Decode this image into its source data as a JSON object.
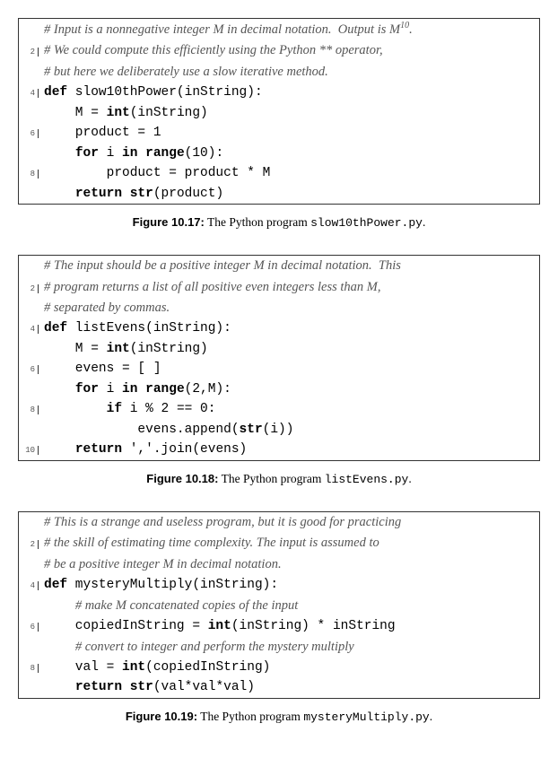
{
  "figures": [
    {
      "caption_label": "Figure 10.17:",
      "caption_text_pre": " The Python program ",
      "caption_tt": "slow10thPower.py",
      "caption_text_post": ".",
      "lines": [
        {
          "num": "",
          "parts": [
            {
              "t": "# Input is a nonnegative integer M in decimal notation.  Output is M",
              "cls": "comment"
            },
            {
              "t": "10",
              "cls": "comment sup",
              "raw": true
            },
            {
              "t": ".",
              "cls": "comment"
            }
          ]
        },
        {
          "num": "2",
          "parts": [
            {
              "t": "# We could compute this efficiently using the Python ** operator,",
              "cls": "comment"
            }
          ]
        },
        {
          "num": "",
          "parts": [
            {
              "t": "# but here we deliberately use a slow iterative method.",
              "cls": "comment"
            }
          ]
        },
        {
          "num": "4",
          "parts": [
            {
              "t": "def",
              "cls": "keyword"
            },
            {
              "t": " slow10thPower(inString):"
            }
          ]
        },
        {
          "num": "",
          "parts": [
            {
              "t": "    M = "
            },
            {
              "t": "int",
              "cls": "builtin"
            },
            {
              "t": "(inString)"
            }
          ]
        },
        {
          "num": "6",
          "parts": [
            {
              "t": "    product = 1"
            }
          ]
        },
        {
          "num": "",
          "parts": [
            {
              "t": "    "
            },
            {
              "t": "for",
              "cls": "keyword"
            },
            {
              "t": " i "
            },
            {
              "t": "in",
              "cls": "keyword"
            },
            {
              "t": " "
            },
            {
              "t": "range",
              "cls": "builtin"
            },
            {
              "t": "(10):"
            }
          ]
        },
        {
          "num": "8",
          "parts": [
            {
              "t": "        product = product * M"
            }
          ]
        },
        {
          "num": "",
          "parts": [
            {
              "t": "    "
            },
            {
              "t": "return",
              "cls": "keyword"
            },
            {
              "t": " "
            },
            {
              "t": "str",
              "cls": "builtin"
            },
            {
              "t": "(product)"
            }
          ]
        }
      ]
    },
    {
      "caption_label": "Figure 10.18:",
      "caption_text_pre": " The Python program ",
      "caption_tt": "listEvens.py",
      "caption_text_post": ".",
      "lines": [
        {
          "num": "",
          "parts": [
            {
              "t": "# The input should be a positive integer M in decimal notation.  This",
              "cls": "comment"
            }
          ]
        },
        {
          "num": "2",
          "parts": [
            {
              "t": "# program returns a list of all positive even integers less than M,",
              "cls": "comment"
            }
          ]
        },
        {
          "num": "",
          "parts": [
            {
              "t": "# separated by commas.",
              "cls": "comment"
            }
          ]
        },
        {
          "num": "4",
          "parts": [
            {
              "t": "def",
              "cls": "keyword"
            },
            {
              "t": " listEvens(inString):"
            }
          ]
        },
        {
          "num": "",
          "parts": [
            {
              "t": "    M = "
            },
            {
              "t": "int",
              "cls": "builtin"
            },
            {
              "t": "(inString)"
            }
          ]
        },
        {
          "num": "6",
          "parts": [
            {
              "t": "    evens = [ ]"
            }
          ]
        },
        {
          "num": "",
          "parts": [
            {
              "t": "    "
            },
            {
              "t": "for",
              "cls": "keyword"
            },
            {
              "t": " i "
            },
            {
              "t": "in",
              "cls": "keyword"
            },
            {
              "t": " "
            },
            {
              "t": "range",
              "cls": "builtin"
            },
            {
              "t": "(2,M):"
            }
          ]
        },
        {
          "num": "8",
          "parts": [
            {
              "t": "        "
            },
            {
              "t": "if",
              "cls": "keyword"
            },
            {
              "t": " i % 2 == 0:"
            }
          ]
        },
        {
          "num": "",
          "parts": [
            {
              "t": "            evens.append("
            },
            {
              "t": "str",
              "cls": "builtin"
            },
            {
              "t": "(i))"
            }
          ]
        },
        {
          "num": "10",
          "parts": [
            {
              "t": "    "
            },
            {
              "t": "return",
              "cls": "keyword"
            },
            {
              "t": " "
            },
            {
              "t": "','",
              "cls": "string"
            },
            {
              "t": ".join(evens)"
            }
          ]
        }
      ]
    },
    {
      "caption_label": "Figure 10.19:",
      "caption_text_pre": " The Python program ",
      "caption_tt": "mysteryMultiply.py",
      "caption_text_post": ".",
      "lines": [
        {
          "num": "",
          "parts": [
            {
              "t": "# This is a strange and useless program, but it is good for practicing",
              "cls": "comment"
            }
          ]
        },
        {
          "num": "2",
          "parts": [
            {
              "t": "# the skill of estimating time complexity. The input is assumed to",
              "cls": "comment"
            }
          ]
        },
        {
          "num": "",
          "parts": [
            {
              "t": "# be a positive integer M in decimal notation.",
              "cls": "comment"
            }
          ]
        },
        {
          "num": "4",
          "parts": [
            {
              "t": "def",
              "cls": "keyword"
            },
            {
              "t": " mysteryMultiply(inString):"
            }
          ]
        },
        {
          "num": "",
          "parts": [
            {
              "t": "    "
            },
            {
              "t": "# make M concatenated copies of the input",
              "cls": "comment"
            }
          ]
        },
        {
          "num": "6",
          "parts": [
            {
              "t": "    copiedInString = "
            },
            {
              "t": "int",
              "cls": "builtin"
            },
            {
              "t": "(inString) * inString"
            }
          ]
        },
        {
          "num": "",
          "parts": [
            {
              "t": "    "
            },
            {
              "t": "# convert to integer and perform the mystery multiply",
              "cls": "comment"
            }
          ]
        },
        {
          "num": "8",
          "parts": [
            {
              "t": "    val = "
            },
            {
              "t": "int",
              "cls": "builtin"
            },
            {
              "t": "(copiedInString)"
            }
          ]
        },
        {
          "num": "",
          "parts": [
            {
              "t": "    "
            },
            {
              "t": "return",
              "cls": "keyword"
            },
            {
              "t": " "
            },
            {
              "t": "str",
              "cls": "builtin"
            },
            {
              "t": "(val*val*val)"
            }
          ]
        }
      ]
    }
  ]
}
